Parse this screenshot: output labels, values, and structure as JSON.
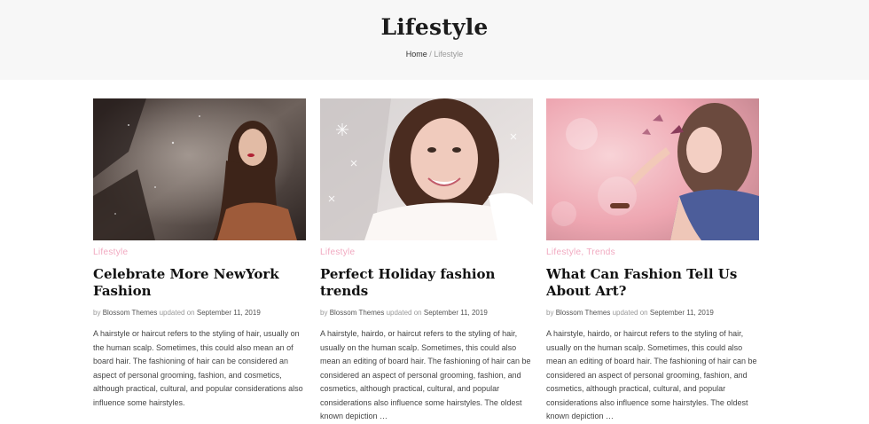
{
  "header": {
    "title": "Lifestyle",
    "breadcrumb": {
      "home": "Home",
      "separator": " / ",
      "current": "Lifestyle"
    }
  },
  "posts": [
    {
      "categories": [
        "Lifestyle"
      ],
      "title": "Celebrate More NewYork Fashion",
      "by": "by",
      "author": "Blossom Themes",
      "updated": "updated on",
      "date": "September 11, 2019",
      "excerpt": "A hairstyle or haircut refers to the styling of hair, usually on the human scalp. Sometimes, this could also mean an of board hair. The fashioning of hair can be considered an aspect of personal grooming, fashion, and cosmetics, although practical, cultural, and popular considerations also influence some hairstyles."
    },
    {
      "categories": [
        "Lifestyle"
      ],
      "title": "Perfect Holiday fashion trends",
      "by": "by",
      "author": "Blossom Themes",
      "updated": "updated on",
      "date": "September 11, 2019",
      "excerpt": "A hairstyle, hairdo, or haircut refers to the styling of hair, usually on the human scalp. Sometimes, this could also mean an editing of board hair. The fashioning of hair can be considered an aspect of personal grooming, fashion, and cosmetics, although practical, cultural, and popular considerations also influence some hairstyles. The oldest known depiction …"
    },
    {
      "categories": [
        "Lifestyle",
        "Trends"
      ],
      "category_separator": ", ",
      "title": "What Can Fashion Tell Us About Art?",
      "by": "by",
      "author": "Blossom Themes",
      "updated": "updated on",
      "date": "September 11, 2019",
      "excerpt": "A hairstyle, hairdo, or haircut refers to the styling of hair, usually on the human scalp. Sometimes, this could also mean an editing of board hair. The fashioning of hair can be considered an aspect of personal grooming, fashion, and cosmetics, although practical, cultural, and popular considerations also influence some hairstyles. The oldest known depiction …"
    }
  ],
  "colors": {
    "accent": "#f1a9c0",
    "header_bg": "#f7f7f7",
    "title": "#111111"
  }
}
